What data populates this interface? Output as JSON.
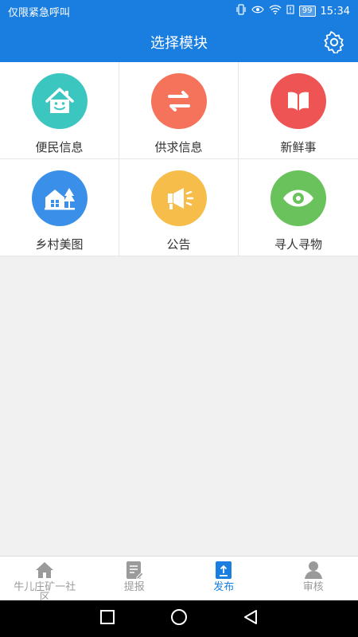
{
  "statusbar": {
    "left_text": "仅限紧急呼叫",
    "battery": "99",
    "time": "15:34"
  },
  "header": {
    "title": "选择模块"
  },
  "modules": [
    {
      "label": "便民信息",
      "icon": "house-smile-icon",
      "color": "#3cc6c0"
    },
    {
      "label": "供求信息",
      "icon": "exchange-arrows-icon",
      "color": "#f4735a"
    },
    {
      "label": "新鲜事",
      "icon": "open-book-icon",
      "color": "#ef5454"
    },
    {
      "label": "乡村美图",
      "icon": "village-trees-icon",
      "color": "#3a8fe8"
    },
    {
      "label": "公告",
      "icon": "megaphone-icon",
      "color": "#f6bd4b"
    },
    {
      "label": "寻人寻物",
      "icon": "eye-icon",
      "color": "#69c25b"
    }
  ],
  "bottom_nav": {
    "items": [
      {
        "label": "牛儿庄矿一社区",
        "icon": "home-icon"
      },
      {
        "label": "提报",
        "icon": "report-edit-icon"
      },
      {
        "label": "发布",
        "icon": "publish-icon"
      },
      {
        "label": "审核",
        "icon": "reviewer-icon"
      }
    ],
    "active_index": 2,
    "active_color": "#1a7ee0"
  },
  "system_nav": {
    "icons": [
      "recent-apps-icon",
      "home-circle-icon",
      "back-triangle-icon"
    ]
  }
}
